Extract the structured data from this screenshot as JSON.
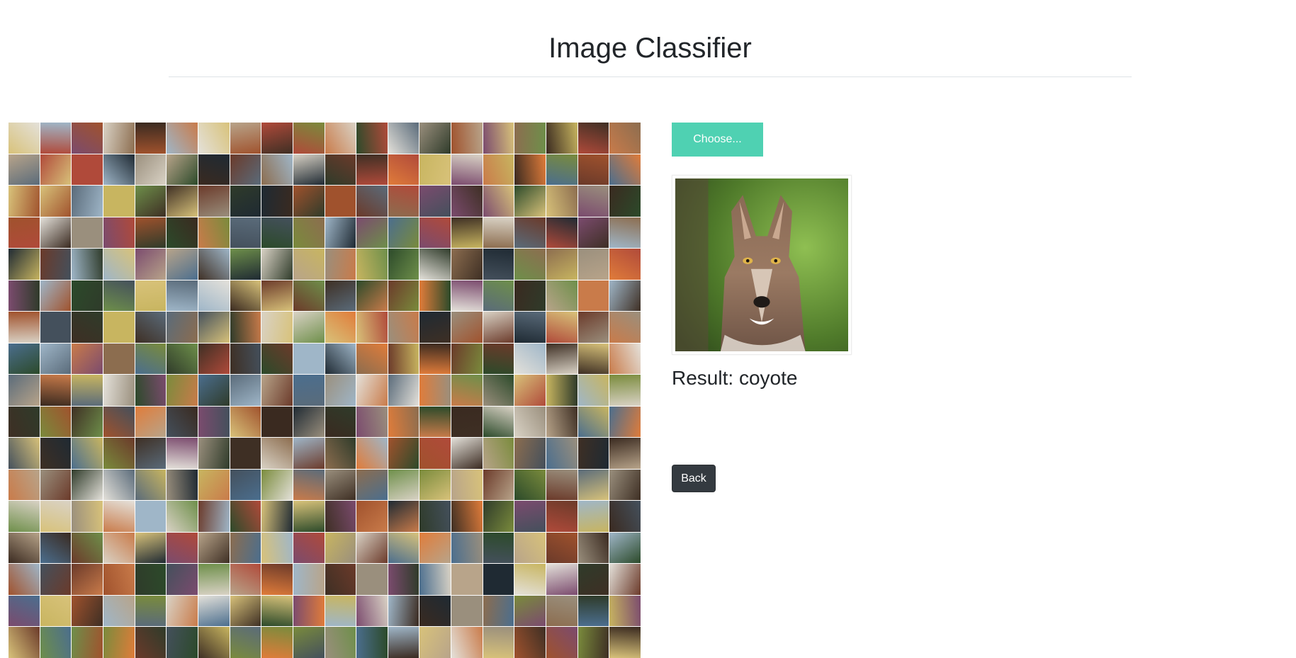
{
  "header": {
    "title": "Image Classifier"
  },
  "upload": {
    "choose_label": "Choose..."
  },
  "preview": {
    "subject": "coyote photo"
  },
  "result": {
    "label": "Result:",
    "value": "coyote"
  },
  "actions": {
    "back_label": "Back"
  },
  "mosaic": {
    "columns": 20,
    "rows": 17,
    "palette": [
      "#6b3a2a",
      "#a0522d",
      "#3e2f24",
      "#c8b560",
      "#7a8b3c",
      "#9fb6c8",
      "#d9d2c5",
      "#5a6b7a",
      "#2f3b2a",
      "#8c6d4f",
      "#b04a3a",
      "#d8c27a",
      "#44505c",
      "#e4e1da",
      "#6e8f4a",
      "#3a2a20",
      "#c97b4a",
      "#1f2a33",
      "#9a8f7d",
      "#4b6e8e",
      "#e07c3a",
      "#7b4b6e",
      "#b8a48a",
      "#2c4a2a"
    ]
  },
  "colors": {
    "accent": "#4fd1b2",
    "dark_button": "#343a40",
    "divider": "#dee2e6"
  }
}
